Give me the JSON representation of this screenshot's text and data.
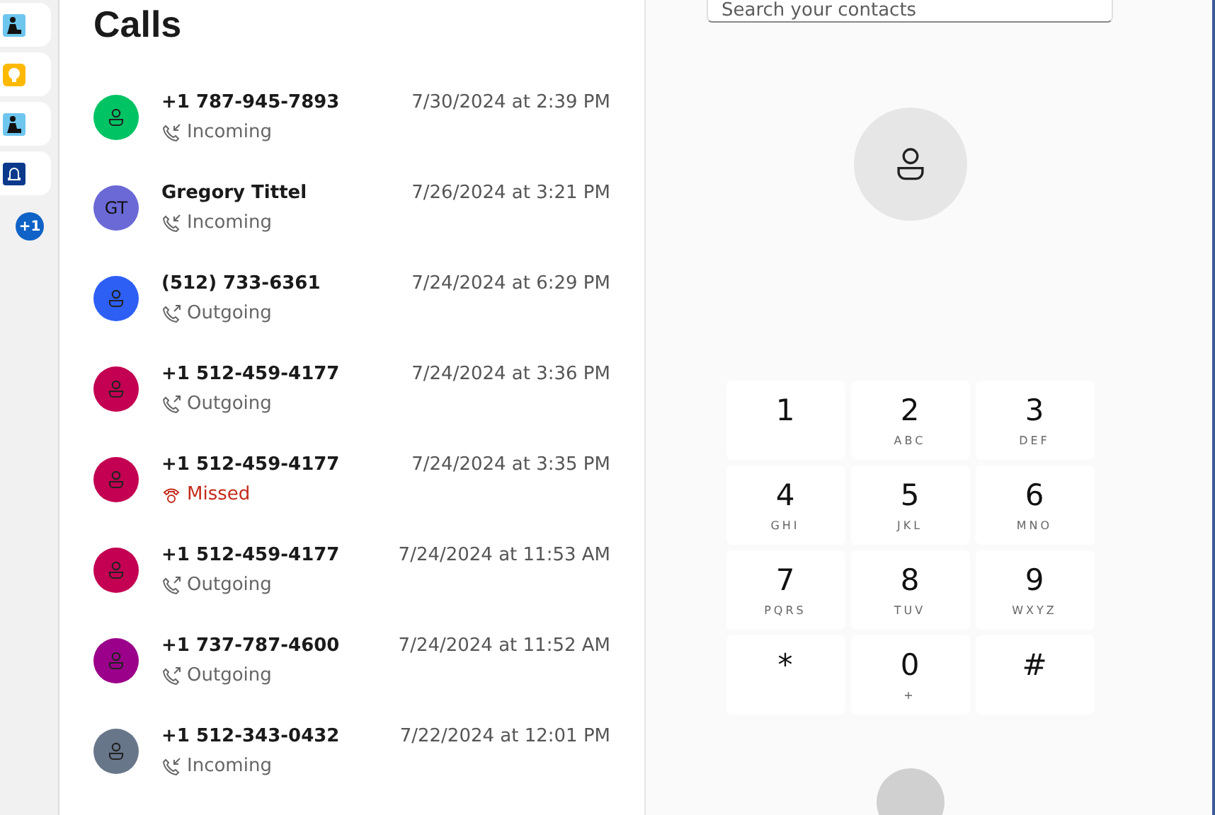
{
  "sidebar": {
    "items": [
      {
        "kind": "reader"
      },
      {
        "kind": "bulb"
      },
      {
        "kind": "reader"
      },
      {
        "kind": "bell"
      }
    ],
    "badge": "+1"
  },
  "title": "Calls",
  "calls": [
    {
      "name": "+1 787-945-7893",
      "color": "#00c464",
      "kind": "incoming",
      "status": "Incoming",
      "time": "7/30/2024 at 2:39 PM"
    },
    {
      "name": "Gregory Tittel",
      "initials": "GT",
      "color": "#6b69d6",
      "kind": "incoming",
      "status": "Incoming",
      "time": "7/26/2024 at 3:21 PM"
    },
    {
      "name": "(512) 733-6361",
      "color": "#2d5ff5",
      "kind": "outgoing",
      "status": "Outgoing",
      "time": "7/24/2024 at 6:29 PM"
    },
    {
      "name": "+1 512-459-4177",
      "color": "#c30052",
      "kind": "outgoing",
      "status": "Outgoing",
      "time": "7/24/2024 at 3:36 PM"
    },
    {
      "name": "+1 512-459-4177",
      "color": "#c30052",
      "kind": "missed",
      "status": "Missed",
      "time": "7/24/2024 at 3:35 PM"
    },
    {
      "name": "+1 512-459-4177",
      "color": "#c30052",
      "kind": "outgoing",
      "status": "Outgoing",
      "time": "7/24/2024 at 11:53 AM"
    },
    {
      "name": "+1 737-787-4600",
      "color": "#9a0089",
      "kind": "outgoing",
      "status": "Outgoing",
      "time": "7/24/2024 at 11:52 AM"
    },
    {
      "name": "+1 512-343-0432",
      "color": "#68768a",
      "kind": "incoming",
      "status": "Incoming",
      "time": "7/22/2024 at 12:01 PM"
    }
  ],
  "search": {
    "placeholder": "Search your contacts"
  },
  "keypad": [
    {
      "digit": "1"
    },
    {
      "digit": "2",
      "letters": "ABC"
    },
    {
      "digit": "3",
      "letters": "DEF"
    },
    {
      "digit": "4",
      "letters": "GHI"
    },
    {
      "digit": "5",
      "letters": "JKL"
    },
    {
      "digit": "6",
      "letters": "MNO"
    },
    {
      "digit": "7",
      "letters": "PQRS"
    },
    {
      "digit": "8",
      "letters": "TUV"
    },
    {
      "digit": "9",
      "letters": "WXYZ"
    },
    {
      "digit": "*"
    },
    {
      "digit": "0",
      "letters": "+"
    },
    {
      "digit": "#"
    }
  ]
}
